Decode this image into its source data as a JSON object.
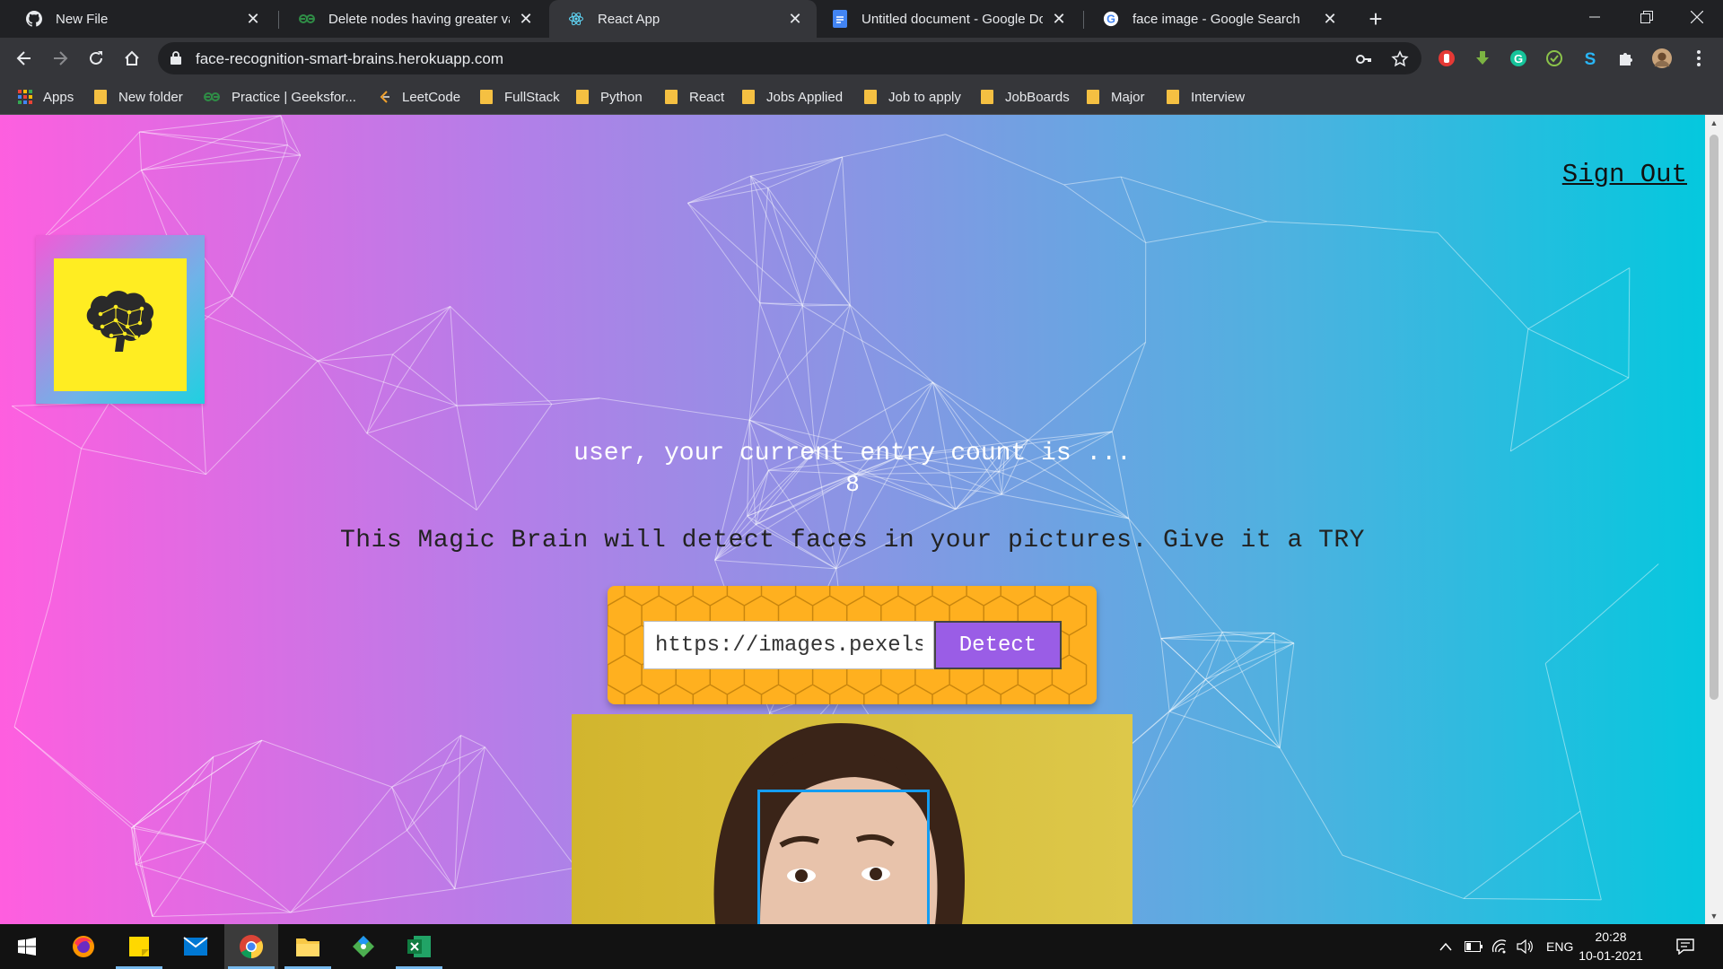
{
  "browser": {
    "tabs": [
      {
        "title": "New File",
        "icon": "github-icon"
      },
      {
        "title": "Delete nodes having greater valu",
        "icon": "geeksforgeeks-icon"
      },
      {
        "title": "React App",
        "icon": "react-icon"
      },
      {
        "title": "Untitled document - Google Doc",
        "icon": "google-docs-icon"
      },
      {
        "title": "face image - Google Search",
        "icon": "google-icon"
      }
    ],
    "active_tab_index": 2,
    "url": "face-recognition-smart-brains.herokuapp.com",
    "bookmarks": [
      {
        "label": "Apps",
        "icon": "apps-grid-icon"
      },
      {
        "label": "New folder",
        "icon": "folder-icon"
      },
      {
        "label": "Practice | Geeksfor...",
        "icon": "geeksforgeeks-icon"
      },
      {
        "label": "LeetCode",
        "icon": "leetcode-icon"
      },
      {
        "label": "FullStack",
        "icon": "folder-icon"
      },
      {
        "label": "Python",
        "icon": "folder-icon"
      },
      {
        "label": "React",
        "icon": "folder-icon"
      },
      {
        "label": "Jobs Applied",
        "icon": "folder-icon"
      },
      {
        "label": "Job to apply",
        "icon": "folder-icon"
      },
      {
        "label": "JobBoards",
        "icon": "folder-icon"
      },
      {
        "label": "Major",
        "icon": "folder-icon"
      },
      {
        "label": "Interview",
        "icon": "folder-icon"
      }
    ]
  },
  "app": {
    "signout_label": "Sign Out",
    "rank_title": "user, your current entry count is ...",
    "entry_count": "8",
    "tagline": "This Magic Brain will detect faces in your pictures. Give it a TRY",
    "image_url_value": "https://images.pexels.com",
    "detect_label": "Detect",
    "colors": {
      "gradient_start": "#ff5edf",
      "gradient_end": "#04c8de",
      "form_bg": "#ffb01f",
      "button": "#9a5de6",
      "face_box": "#149df2",
      "logo_bg": "#ffed22"
    }
  },
  "taskbar": {
    "apps": [
      "windows-start-icon",
      "firefox-icon",
      "sticky-notes-icon",
      "mail-icon",
      "chrome-icon",
      "file-explorer-icon",
      "git-icon",
      "excel-icon"
    ],
    "language": "ENG",
    "time": "20:28",
    "date": "10-01-2021"
  }
}
